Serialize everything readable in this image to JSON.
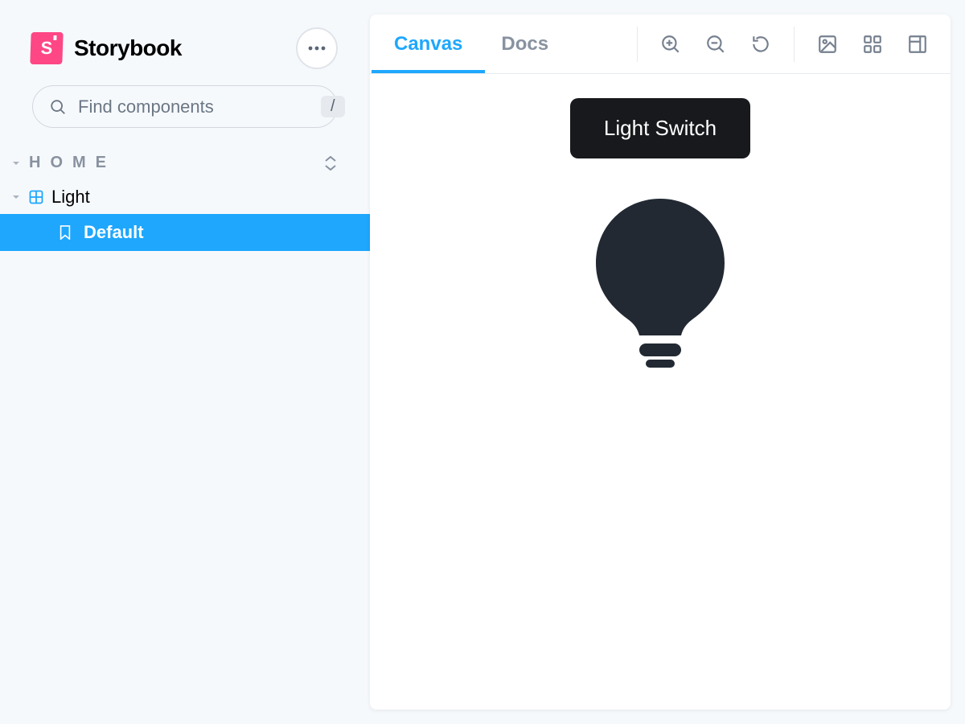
{
  "app": {
    "name": "Storybook",
    "logo_letter": "S"
  },
  "search": {
    "placeholder": "Find components",
    "shortcut": "/"
  },
  "section": {
    "title": "HOME"
  },
  "tree": {
    "component": {
      "label": "Light"
    },
    "story": {
      "label": "Default"
    }
  },
  "tabs": {
    "canvas": "Canvas",
    "docs": "Docs",
    "active": "canvas"
  },
  "toolbar": {
    "zoom_in": "zoom-in",
    "zoom_out": "zoom-out",
    "reset": "reset-zoom",
    "image": "background",
    "grid": "grid",
    "docs": "open-docs"
  },
  "preview": {
    "button_label": "Light Switch"
  }
}
